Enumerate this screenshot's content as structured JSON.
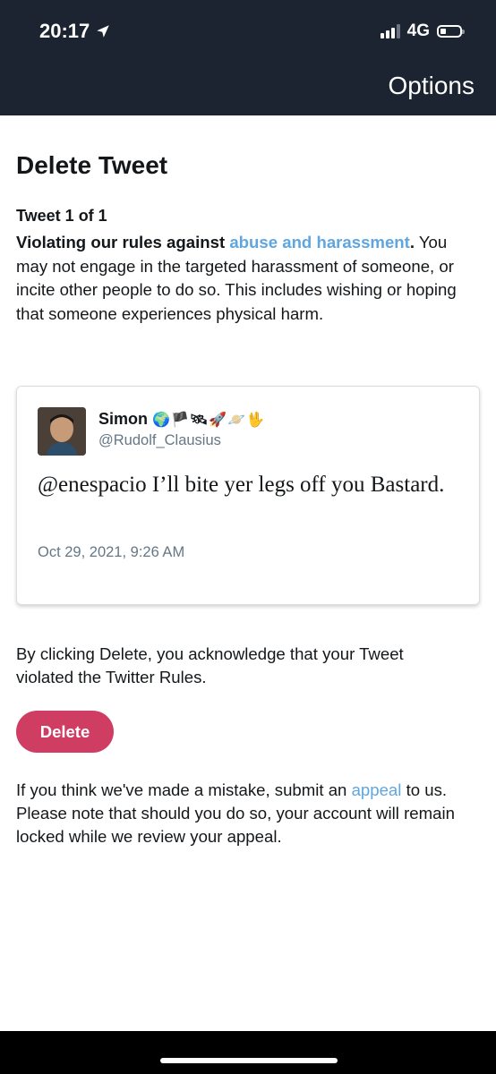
{
  "status_bar": {
    "time": "20:17",
    "network": "4G"
  },
  "nav": {
    "options_label": "Options"
  },
  "page": {
    "title": "Delete Tweet",
    "tweet_count": "Tweet 1 of 1",
    "rules_prefix": "Violating our rules against ",
    "rules_link": "abuse and harassment",
    "rules_suffix": ".",
    "rules_body": " You may not engage in the targeted harassment of someone, or incite other people to do so. This includes wishing or hoping that someone experiences physical harm."
  },
  "tweet": {
    "name": "Simon",
    "emojis": "🌍🏴🛰🚀🪐🖖",
    "handle": "@Rudolf_Clausius",
    "text": "@enespacio I’ll bite yer legs off you Bastard.",
    "date": "Oct 29, 2021, 9:26 AM"
  },
  "acknowledgement": "By clicking Delete, you acknowledge that your Tweet violated the Twitter Rules.",
  "delete_label": "Delete",
  "appeal": {
    "prefix": "If you think we've made a mistake, submit an ",
    "link": "appeal",
    "suffix": " to us. Please note that should you do so, your account will remain locked while we review your appeal."
  },
  "colors": {
    "header_bg": "#1b2430",
    "link": "#5fa6e0",
    "delete_button": "#cf3d63"
  },
  "icons": [
    "location-arrow-icon",
    "signal-icon",
    "battery-icon"
  ]
}
